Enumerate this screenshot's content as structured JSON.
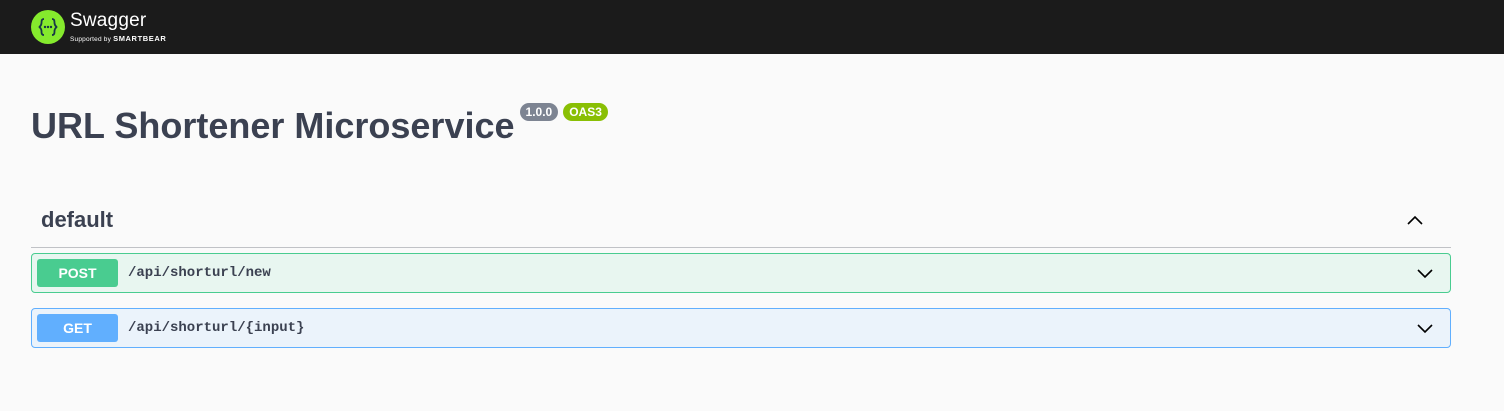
{
  "topbar": {
    "logo_name": "Swagger",
    "logo_sub_prefix": "Supported by",
    "logo_sub_brand": "SMARTBEAR",
    "logo_color": "#85ea2d"
  },
  "info": {
    "title": "URL Shortener Microservice",
    "version": "1.0.0",
    "oas_badge": "OAS3"
  },
  "tag": {
    "name": "default",
    "expanded": true
  },
  "operations": [
    {
      "method": "POST",
      "path": "/api/shorturl/new",
      "color": "#49cc90"
    },
    {
      "method": "GET",
      "path": "/api/shorturl/{input}",
      "color": "#61affe"
    }
  ]
}
